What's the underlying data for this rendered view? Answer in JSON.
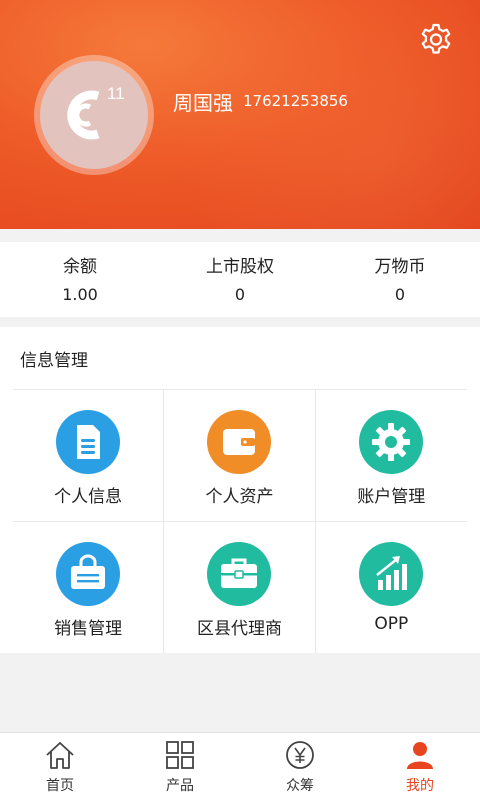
{
  "header": {
    "user_name": "周国强",
    "user_phone": "17621253856",
    "avatar_badge": "11",
    "settings_icon": "gear-icon",
    "accent_color": "#ee5a28"
  },
  "stats": [
    {
      "label": "余额",
      "value": "1.00"
    },
    {
      "label": "上市股权",
      "value": "0"
    },
    {
      "label": "万物币",
      "value": "0"
    }
  ],
  "info": {
    "title": "信息管理",
    "items": [
      {
        "label": "个人信息",
        "icon": "document-icon",
        "color": "#2a9fe4"
      },
      {
        "label": "个人资产",
        "icon": "wallet-icon",
        "color": "#f08d26"
      },
      {
        "label": "账户管理",
        "icon": "gear-icon",
        "color": "#21bca0"
      },
      {
        "label": "销售管理",
        "icon": "shopping-bag-icon",
        "color": "#2a9fe4"
      },
      {
        "label": "区县代理商",
        "icon": "briefcase-icon",
        "color": "#21bca0"
      },
      {
        "label": "OPP",
        "icon": "bar-chart-icon",
        "color": "#21bca0"
      }
    ]
  },
  "tabbar": {
    "items": [
      {
        "label": "首页",
        "icon": "home-icon"
      },
      {
        "label": "产品",
        "icon": "grid-icon"
      },
      {
        "label": "众筹",
        "icon": "yen-coin-icon"
      },
      {
        "label": "我的",
        "icon": "user-icon"
      }
    ],
    "active_color": "#e8441f"
  }
}
